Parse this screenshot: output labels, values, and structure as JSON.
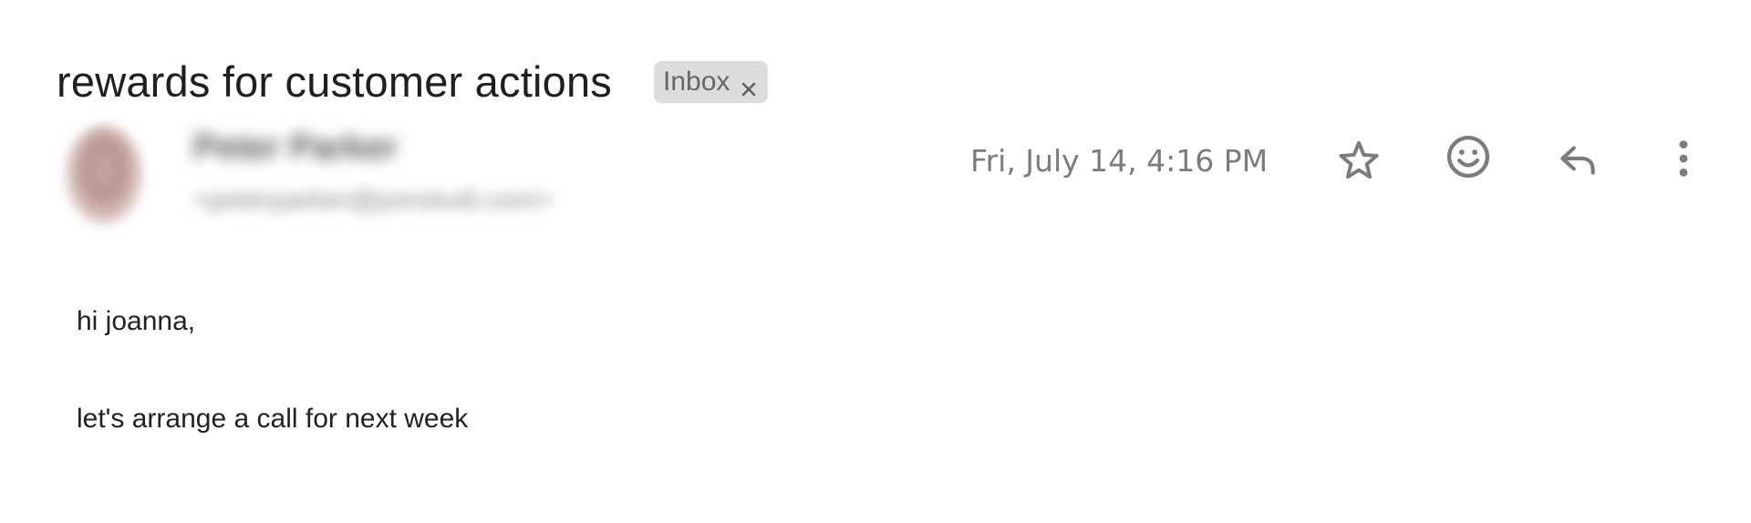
{
  "email": {
    "subject": "rewards for customer actions",
    "label": {
      "text": "Inbox",
      "remove_icon": "close-icon"
    },
    "sender": {
      "name": "Peter Parker",
      "email": "<peterparker@joinstudi.com>",
      "blurred": true
    },
    "date": "Fri, July 14, 4:16 PM",
    "actions": [
      {
        "name": "star",
        "icon": "star-icon"
      },
      {
        "name": "react",
        "icon": "emoji-icon"
      },
      {
        "name": "reply",
        "icon": "reply-icon"
      },
      {
        "name": "more",
        "icon": "more-vert-icon"
      }
    ],
    "body": {
      "greeting": "hi joanna,",
      "message": "let's arrange a call for next week"
    }
  },
  "colors": {
    "chip_background": "#dddddd",
    "chip_text": "#666666",
    "date_text": "#7b7b7b",
    "icon": "#7b7b7b",
    "body_text": "#222222"
  }
}
